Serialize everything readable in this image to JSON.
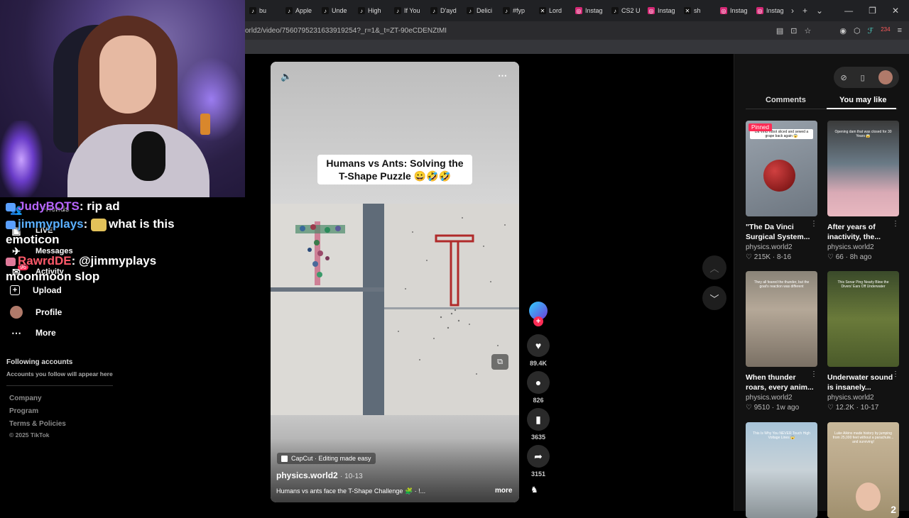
{
  "tabs": [
    {
      "label": "bu",
      "icon": "tiktok"
    },
    {
      "label": "Apple",
      "icon": "tiktok"
    },
    {
      "label": "Unde",
      "icon": "tiktok"
    },
    {
      "label": "High",
      "icon": "tiktok"
    },
    {
      "label": "If You",
      "icon": "tiktok"
    },
    {
      "label": "D'ayd",
      "icon": "tiktok"
    },
    {
      "label": "Delici",
      "icon": "tiktok"
    },
    {
      "label": "#fyp",
      "icon": "tiktok"
    },
    {
      "label": "Lord",
      "icon": "x"
    },
    {
      "label": "Instag",
      "icon": "instagram"
    },
    {
      "label": "CS2 U",
      "icon": "tiktok"
    },
    {
      "label": "Instag",
      "icon": "instagram"
    },
    {
      "label": "sh",
      "icon": "x"
    },
    {
      "label": "Instag",
      "icon": "instagram"
    },
    {
      "label": "Instag",
      "icon": "instagram"
    }
  ],
  "address": {
    "url": "orld2/video/7560795231633919254?_r=1&_t=ZT-90eCDENZtMI"
  },
  "browser": {
    "badge_count": "234"
  },
  "chat": [
    {
      "user": "JudyBOTS",
      "message": "rip ad"
    },
    {
      "user": "jimmyplays",
      "message": "what is this emoticon"
    },
    {
      "user": "RawrdDE",
      "message": "@jimmyplays moonmoon slop"
    }
  ],
  "sidebar": {
    "items": [
      {
        "label": "Friends"
      },
      {
        "label": "LIVE"
      },
      {
        "label": "Messages"
      },
      {
        "label": "Activity",
        "badge": "96"
      },
      {
        "label": "Upload"
      },
      {
        "label": "Profile"
      },
      {
        "label": "More"
      }
    ],
    "following_title": "Following accounts",
    "following_hint": "Accounts you follow will appear here",
    "footer": [
      "Company",
      "Program",
      "Terms & Policies"
    ],
    "copyright": "© 2025 TikTok"
  },
  "video": {
    "caption_line1": "Humans vs Ants: Solving the",
    "caption_line2": "T-Shape Puzzle 😀🤣🤣",
    "capcut": "CapCut · Editing made easy",
    "author": "physics.world2",
    "date": "· 10-13",
    "description": "Humans vs ants face the T-Shape Challenge 🧩 · !...",
    "more": "more"
  },
  "actions": {
    "likes": "89.4K",
    "comments": "826",
    "saves": "3635",
    "shares": "3151"
  },
  "panel": {
    "tab_comments": "Comments",
    "tab_like": "You may like",
    "cards": [
      {
        "title": "\"The Da Vinci Surgical System...",
        "author": "physics.world2",
        "likes": "215K",
        "age": "8-16",
        "pinned": "Pinned",
        "thumb_text": "Da Vinci robot sliced and sewed a grape back again 😱"
      },
      {
        "title": "After years of inactivity, the...",
        "author": "physics.world2",
        "likes": "66",
        "age": "8h ago",
        "thumb_text": "Opening dam that was closed for 30 Years 😱"
      },
      {
        "title": "When thunder roars, every anim...",
        "author": "physics.world2",
        "likes": "9510",
        "age": "1w ago",
        "thumb_text": "They all feared the thunder, but the goat's reaction was different"
      },
      {
        "title": "Underwater sound is insanely...",
        "author": "physics.world2",
        "likes": "12.2K",
        "age": "10-17",
        "thumb_text": "This Sonar Ping Nearly Blew the Divers' Ears Off Underwater"
      },
      {
        "title": "",
        "author": "",
        "likes": "",
        "age": "",
        "thumb_text": "This Is Why You NEVER Touch High Voltage Lines 😱"
      },
      {
        "title": "",
        "author": "",
        "likes": "",
        "age": "",
        "thumb_text": "Luke Aikins made history by jumping from 25,000 feet without a parachute... and surviving!",
        "thumb_num": "2"
      }
    ]
  }
}
